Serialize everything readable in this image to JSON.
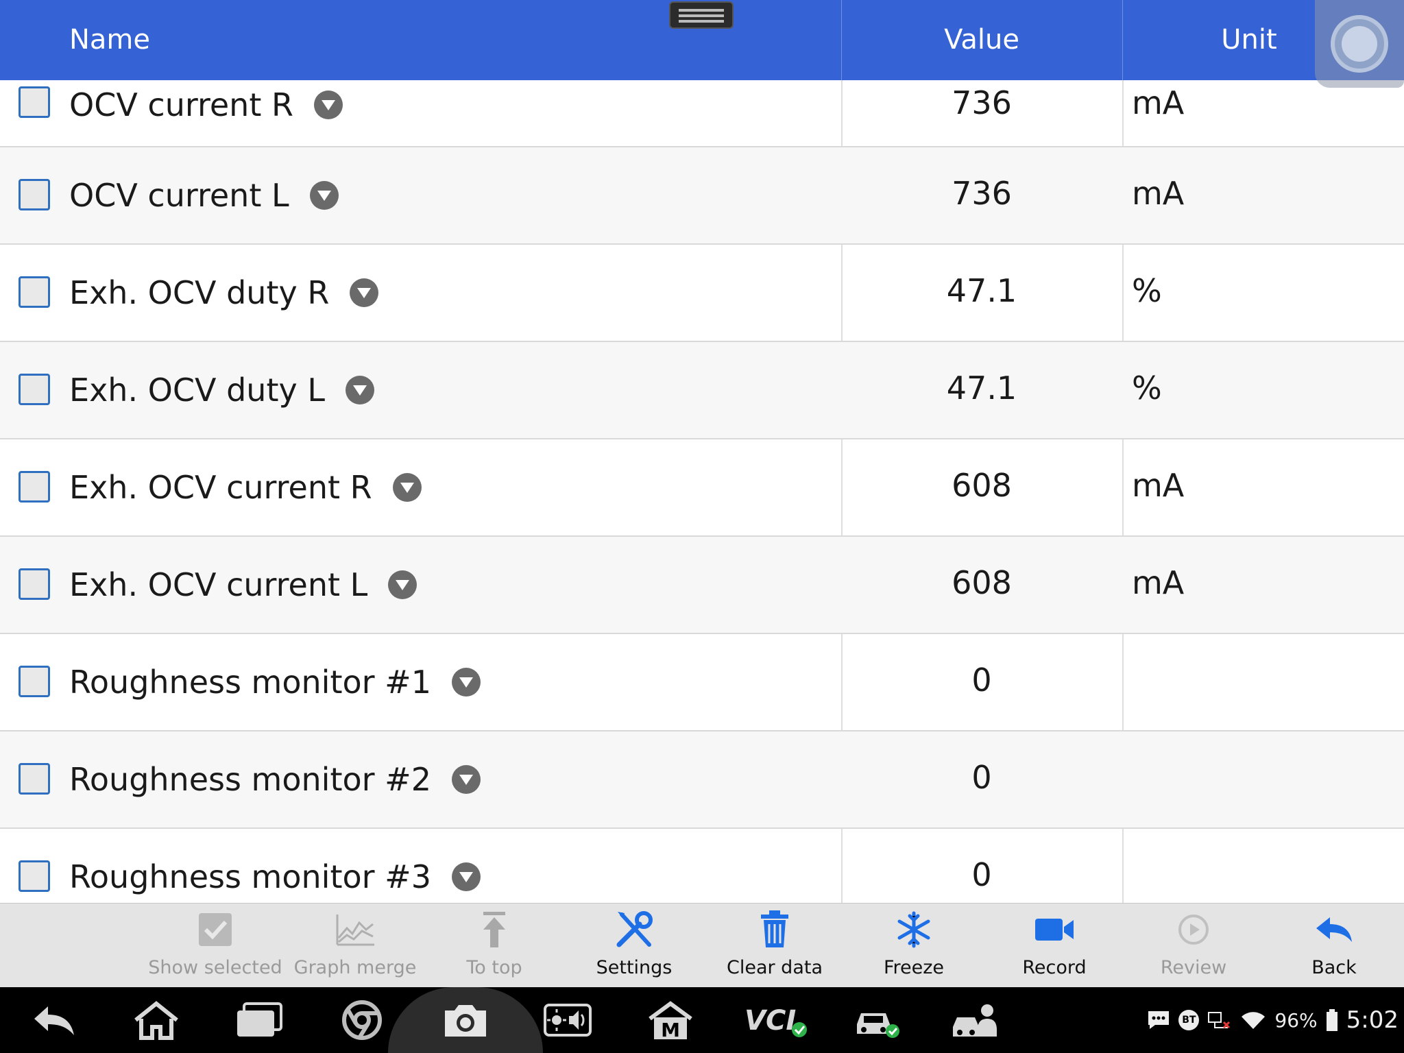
{
  "header": {
    "name_label": "Name",
    "value_label": "Value",
    "unit_label": "Unit"
  },
  "rows": [
    {
      "name": "OCV current R",
      "value": "736",
      "unit": "mA"
    },
    {
      "name": "OCV current L",
      "value": "736",
      "unit": "mA"
    },
    {
      "name": "Exh. OCV duty R",
      "value": "47.1",
      "unit": "%"
    },
    {
      "name": "Exh. OCV duty L",
      "value": "47.1",
      "unit": "%"
    },
    {
      "name": "Exh. OCV current R",
      "value": "608",
      "unit": "mA"
    },
    {
      "name": "Exh. OCV current L",
      "value": "608",
      "unit": "mA"
    },
    {
      "name": "Roughness monitor #1",
      "value": "0",
      "unit": ""
    },
    {
      "name": "Roughness monitor #2",
      "value": "0",
      "unit": ""
    },
    {
      "name": "Roughness monitor #3",
      "value": "0",
      "unit": ""
    }
  ],
  "toolbar": {
    "show_selected": "Show selected",
    "graph_merge": "Graph merge",
    "to_top": "To top",
    "settings": "Settings",
    "clear_data": "Clear data",
    "freeze": "Freeze",
    "record": "Record",
    "review": "Review",
    "back": "Back"
  },
  "status": {
    "bt": "BT",
    "battery": "96%",
    "time": "5:02",
    "vci_label": "VCI",
    "m_label": "M"
  },
  "colors": {
    "header_bg": "#3562d4",
    "accent_blue": "#1e6fe6",
    "checkbox_border": "#2f6fbf",
    "ok_green": "#2fb24a"
  }
}
